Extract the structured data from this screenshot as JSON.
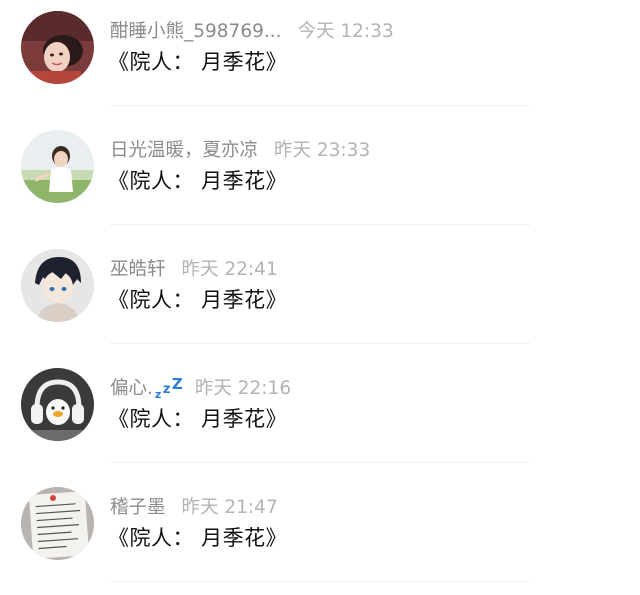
{
  "comments": [
    {
      "name": "酣睡小熊_598769...",
      "time": "今天 12:33",
      "text": "《院人： 月季花》",
      "avatar_icon": "avatar-girl-lying"
    },
    {
      "name": "日光温暖，夏亦凉",
      "time": "昨天 23:33",
      "text": "《院人： 月季花》",
      "avatar_icon": "avatar-girl-outdoors"
    },
    {
      "name": "巫皓轩",
      "time": "昨天 22:41",
      "text": "《院人： 月季花》",
      "avatar_icon": "avatar-anime-boy"
    },
    {
      "name": "偏心.",
      "time": "昨天 22:16",
      "text": "《院人： 月季花》",
      "avatar_icon": "avatar-headphones-duck",
      "name_suffix_icon": "sleep-zzz-icon"
    },
    {
      "name": "稽子墨",
      "time": "昨天 21:47",
      "text": "《院人： 月季花》",
      "avatar_icon": "avatar-handwritten-note"
    }
  ],
  "colors": {
    "name": "#8c8c8c",
    "time": "#b3b3b3",
    "text": "#111111",
    "divider": "#efefef",
    "zzz": "#2f7bd8"
  }
}
